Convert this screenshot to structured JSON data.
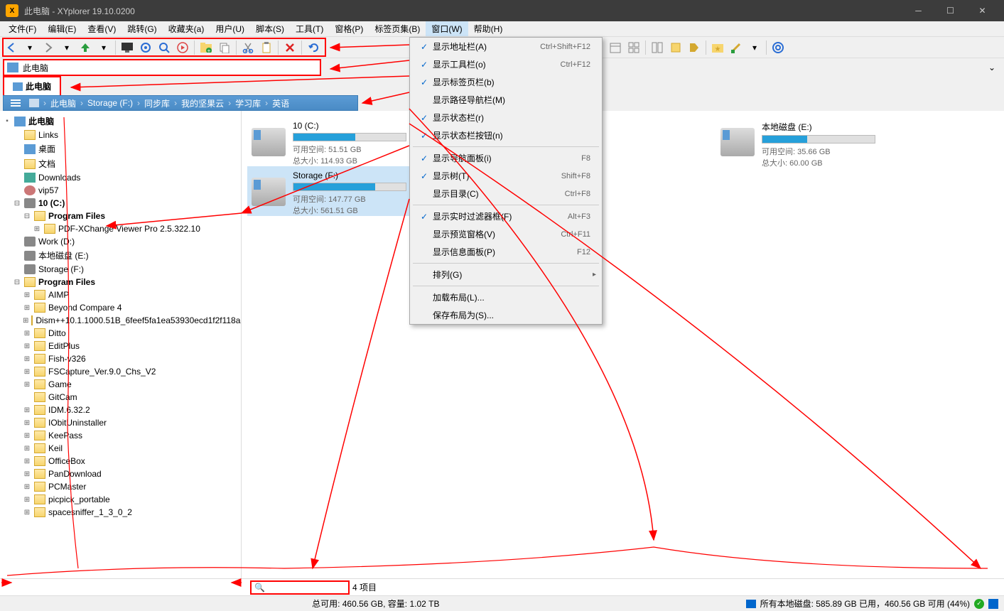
{
  "title": "此电脑 - XYplorer 19.10.0200",
  "menubar": {
    "file": "文件(F)",
    "edit": "编辑(E)",
    "view": "查看(V)",
    "go": "跳转(G)",
    "favorites": "收藏夹(a)",
    "user": "用户(U)",
    "scripting": "脚本(S)",
    "tools": "工具(T)",
    "panes": "窗格(P)",
    "tabsets": "标签页集(B)",
    "window": "窗口(W)",
    "help": "帮助(H)"
  },
  "addressbar": {
    "path": "此电脑"
  },
  "tab": {
    "label": "此电脑"
  },
  "breadcrumb": {
    "root": "此电脑",
    "storage": "Storage (F:)",
    "sync": "同步库",
    "nut": "我的坚果云",
    "study": "学习库",
    "eng": "英语"
  },
  "tree": {
    "thispc": "此电脑",
    "links": "Links",
    "desktop": "桌面",
    "docs": "文档",
    "downloads": "Downloads",
    "vip57": "vip57",
    "drive_c": "10 (C:)",
    "program_files_c": "Program Files",
    "pdfx": "PDF-XChange Viewer Pro 2.5.322.10",
    "drive_d": "Work (D:)",
    "drive_e": "本地磁盘 (E:)",
    "drive_f": "Storage (F:)",
    "program_files_f": "Program Files",
    "aimp": "AIMP",
    "bc4": "Beyond Compare 4",
    "dism": "Dism++10.1.1000.51B_6feef5fa1ea53930ecd1f2f118a",
    "ditto": "Ditto",
    "editplus": "EditPlus",
    "fish": "Fish-v326",
    "fsc": "FSCapture_Ver.9.0_Chs_V2",
    "game": "Game",
    "gitcam": "GitCam",
    "idm": "IDM.6.32.2",
    "iobit": "IObitUninstaller",
    "keepass": "KeePass",
    "keil": "Keil",
    "officebox": "OfficeBox",
    "pandl": "PanDownload",
    "pcmaster": "PCMaster",
    "picpick": "picpick_portable",
    "spacesniffer": "spacesniffer_1_3_0_2"
  },
  "drives": {
    "c": {
      "name": "10 (C:)",
      "avail_label": "可用空间:",
      "avail": "51.51 GB",
      "total_label": "总大小:",
      "total": "114.93 GB",
      "fill": 55
    },
    "e": {
      "name": "本地磁盘 (E:)",
      "avail_label": "可用空间:",
      "avail": "35.66 GB",
      "total_label": "总大小:",
      "total": "60.00 GB",
      "fill": 40
    },
    "f": {
      "name": "Storage (F:)",
      "avail_label": "可用空间:",
      "avail": "147.77 GB",
      "total_label": "总大小:",
      "total": "561.51 GB",
      "fill": 73
    }
  },
  "menu": {
    "addressbar": {
      "label": "显示地址栏(A)",
      "shortcut": "Ctrl+Shift+F12",
      "checked": true
    },
    "toolbar": {
      "label": "显示工具栏(o)",
      "shortcut": "Ctrl+F12",
      "checked": true
    },
    "tabbar": {
      "label": "显示标签页栏(b)",
      "shortcut": "",
      "checked": true
    },
    "breadcrumb": {
      "label": "显示路径导航栏(M)",
      "shortcut": "",
      "checked": false
    },
    "statusbar": {
      "label": "显示状态栏(r)",
      "shortcut": "",
      "checked": true
    },
    "statusbtns": {
      "label": "显示状态栏按钮(n)",
      "shortcut": "",
      "checked": true
    },
    "navpanel": {
      "label": "显示导航面板(i)",
      "shortcut": "F8",
      "checked": true
    },
    "tree": {
      "label": "显示树(T)",
      "shortcut": "Shift+F8",
      "checked": true
    },
    "catalog": {
      "label": "显示目录(C)",
      "shortcut": "Ctrl+F8",
      "checked": false
    },
    "filterbox": {
      "label": "显示实时过滤器框(F)",
      "shortcut": "Alt+F3",
      "checked": true
    },
    "preview": {
      "label": "显示预览窗格(V)",
      "shortcut": "Ctrl+F11",
      "checked": false
    },
    "infopanel": {
      "label": "显示信息面板(P)",
      "shortcut": "F12",
      "checked": false
    },
    "arrange": {
      "label": "排列(G)",
      "submenu": true
    },
    "loadlayout": {
      "label": "加载布局(L)..."
    },
    "savelayout": {
      "label": "保存布局为(S)..."
    }
  },
  "status": {
    "item_count": "4 项目",
    "total_avail": "总可用: 460.56 GB, 容量: 1.02 TB",
    "all_drives": "所有本地磁盘: 585.89 GB 已用，460.56 GB 可用 (44%)"
  }
}
